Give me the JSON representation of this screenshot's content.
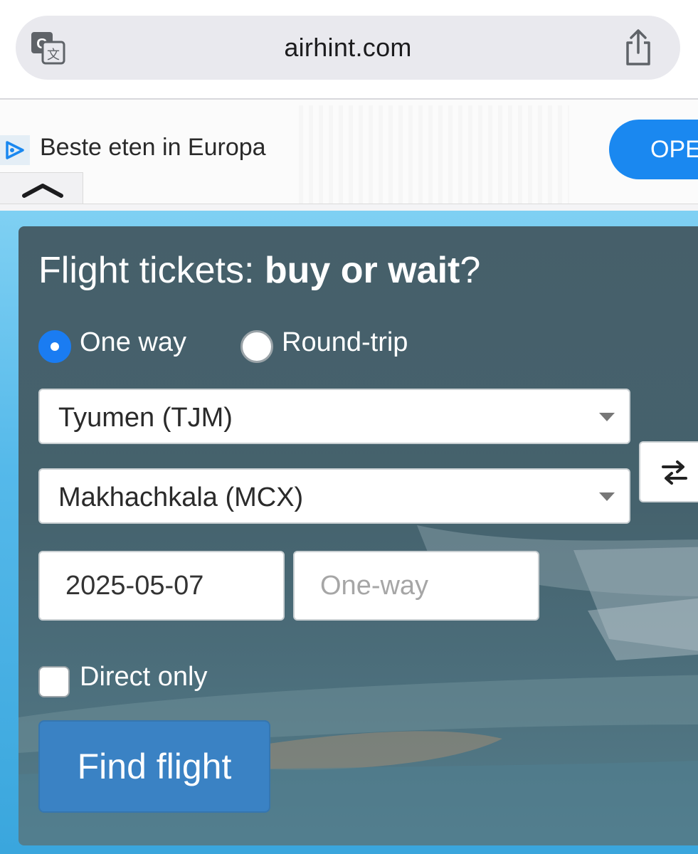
{
  "browser": {
    "url": "airhint.com",
    "translate_icon": "translate-icon",
    "share_icon": "share-icon"
  },
  "ad": {
    "icon": "ad-choices-icon",
    "text": "Beste eten in Europa",
    "button_label": "OPE",
    "collapse_icon": "chevron-up-icon"
  },
  "form": {
    "title_regular": "Flight tickets: ",
    "title_bold": "buy or wait",
    "title_end": "?",
    "trip_types": [
      {
        "label": "One way",
        "selected": true
      },
      {
        "label": "Round-trip",
        "selected": false
      }
    ],
    "origin": "Tyumen (TJM)",
    "destination": "Makhachkala (MCX)",
    "swap_icon": "swap-arrows-icon",
    "depart_date": "2025-05-07",
    "return_placeholder": "One-way",
    "direct_only": {
      "label": "Direct only",
      "checked": false
    },
    "submit_label": "Find flight"
  },
  "colors": {
    "accent_blue": "#1a7cf2",
    "button_blue": "#3a82c4",
    "sky": "#55b9ea",
    "card_overlay": "#465f6a"
  }
}
